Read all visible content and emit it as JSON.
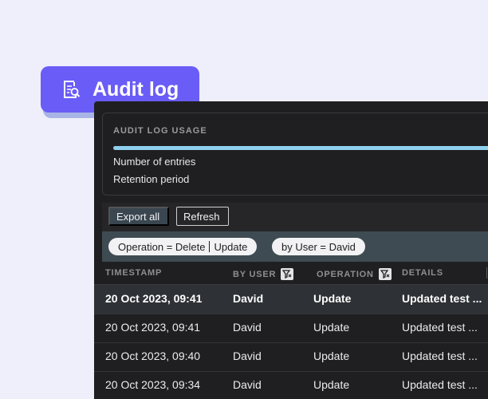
{
  "badge": {
    "label": "Audit log",
    "icon": "audit-document-icon"
  },
  "usage": {
    "title": "AUDIT LOG USAGE",
    "progress_fraction": 1.0,
    "rows": [
      "Number of entries",
      "Retention period"
    ]
  },
  "toolbar": {
    "export_label": "Export all",
    "refresh_label": "Refresh"
  },
  "filters": {
    "operation_key": "Operation = Delete",
    "operation_more": "Update",
    "user": "by User = David"
  },
  "table": {
    "columns": [
      "TIMESTAMP",
      "BY USER",
      "OPERATION",
      "DETAILS"
    ],
    "rows": [
      {
        "timestamp": "20 Oct 2023, 09:41",
        "user": "David",
        "operation": "Update",
        "details": "Updated test ..."
      },
      {
        "timestamp": "20 Oct 2023, 09:41",
        "user": "David",
        "operation": "Update",
        "details": "Updated test ..."
      },
      {
        "timestamp": "20 Oct 2023, 09:40",
        "user": "David",
        "operation": "Update",
        "details": "Updated test ..."
      },
      {
        "timestamp": "20 Oct 2023, 09:34",
        "user": "David",
        "operation": "Update",
        "details": "Updated test ..."
      }
    ]
  },
  "colors": {
    "accent": "#6a5cf6",
    "progress": "#8fd0f0",
    "panel": "#1f1f21"
  }
}
